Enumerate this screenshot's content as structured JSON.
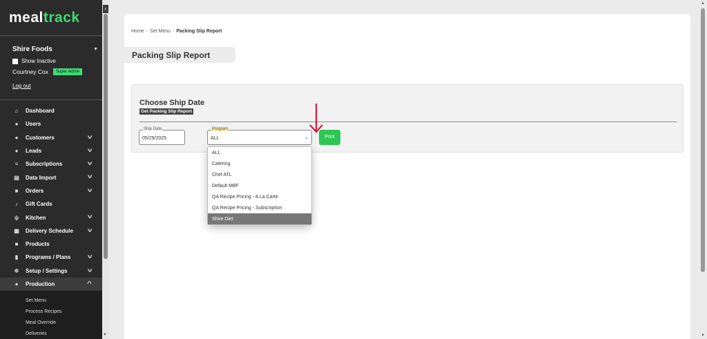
{
  "brand": {
    "logo_part1": "meal",
    "logo_part2": "track"
  },
  "org": {
    "name": "Shire Foods",
    "show_inactive": "Show Inactive",
    "user": "Courtney Cox",
    "role": "Super Admin",
    "logout": "Log out"
  },
  "nav": {
    "dashboard": "Dashboard",
    "users": "Users",
    "customers": "Customers",
    "leads": "Leads",
    "subscriptions": "Subscriptions",
    "data_import": "Data Import",
    "orders": "Orders",
    "gift_cards": "Gift Cards",
    "kitchen": "Kitchen",
    "delivery_schedule": "Delivery Schedule",
    "products": "Products",
    "programs_plans": "Programs / Plans",
    "setup_settings": "Setup / Settings",
    "production": "Production"
  },
  "production_sub": {
    "set_menu": "Set Menu",
    "process_recipes": "Process Recipes",
    "meal_override": "Meal Override",
    "deliveries": "Deliveries"
  },
  "breadcrumb": {
    "home": "Home",
    "set_menu": "Set Menu",
    "current": "Packing Slip Report"
  },
  "page": {
    "title": "Packing Slip Report"
  },
  "panel": {
    "title": "Choose Ship Date",
    "subtitle": "Get Packing Slip Report"
  },
  "form": {
    "ship_date_label": "Ship Date",
    "ship_date_value": "05/29/2025",
    "program_label": "Program",
    "program_value": "ALL",
    "print": "Print"
  },
  "program_options": [
    "ALL",
    "Catering",
    "Chef ATL",
    "Default MBF",
    "QA Recipe Pricing - A La Carte",
    "QA Recipe Pricing - Subscription",
    "Shire Diet"
  ],
  "colors": {
    "accent": "#2dc653",
    "annotation_arrow": "#d9183b"
  }
}
